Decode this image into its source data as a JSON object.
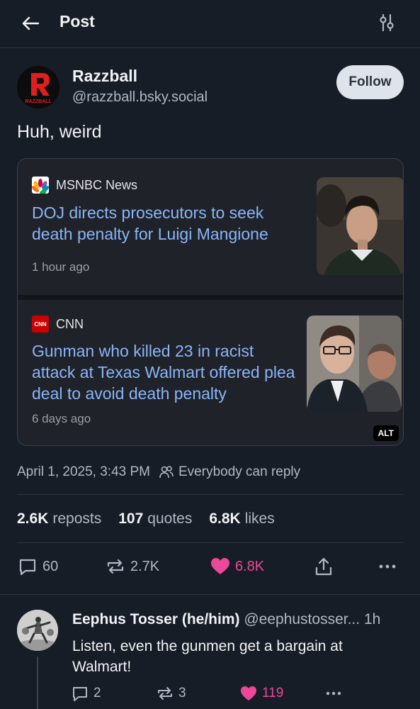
{
  "header": {
    "title": "Post",
    "back_icon": "arrow-left-icon",
    "filter_icon": "sliders-icon"
  },
  "post": {
    "author_name": "Razzball",
    "author_handle": "@razzball.bsky.social",
    "avatar_text": "RAZZBALL",
    "follow_label": "Follow",
    "text": "Huh, weird",
    "timestamp": "April 1, 2025, 3:43 PM",
    "reply_setting": "Everybody can reply"
  },
  "news": [
    {
      "source": "MSNBC News",
      "headline": "DOJ directs prosecutors to seek death penalty for Luigi Mangione",
      "time": "1 hour ago"
    },
    {
      "source": "CNN",
      "source_logo": "CNN",
      "headline": "Gunman who killed 23 in racist attack at Texas Walmart offered plea deal to avoid death penalty",
      "time": "6 days ago",
      "alt": "ALT"
    }
  ],
  "stats": {
    "reposts_count": "2.6K",
    "reposts_label": "reposts",
    "quotes_count": "107",
    "quotes_label": "quotes",
    "likes_count": "6.8K",
    "likes_label": "likes"
  },
  "actions": {
    "replies": "60",
    "reposts": "2.7K",
    "likes": "6.8K"
  },
  "reply": {
    "name": "Eephus Tosser (he/him)",
    "handle": "@eephustosser...",
    "time": "1h",
    "text": "Listen, even the gunmen get a bargain at Walmart!",
    "replies": "2",
    "reposts": "3",
    "likes": "119"
  },
  "colors": {
    "background": "#171d26",
    "link": "#8ab4f8",
    "like": "#ec4899",
    "follow_bg": "#dfe4ea"
  }
}
